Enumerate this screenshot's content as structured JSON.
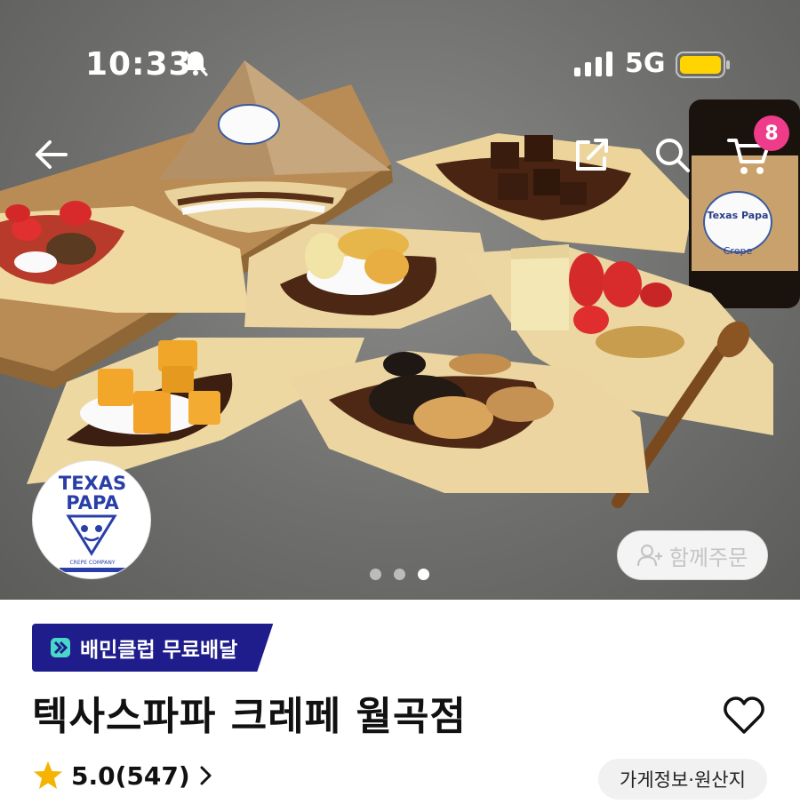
{
  "status_bar": {
    "time": "10:33",
    "network": "5G"
  },
  "nav": {
    "cart_count": "8"
  },
  "hero": {
    "cup_brand": "Texas Papa",
    "cup_sub": "Crepe",
    "slide_count": 3,
    "active_slide_index": 2,
    "together_order_label": "함께주문"
  },
  "logo": {
    "line1": "TEXAS",
    "line2": "PAPA",
    "sub": "CREPE COMPANY"
  },
  "store": {
    "club_badge": "배민클럽 무료배달",
    "title": "텍사스파파 크레페 월곡점",
    "rating": "5.0(547)",
    "info_button": "가게정보·원산지"
  },
  "colors": {
    "club_badge_bg": "#1f1d8c",
    "cart_badge": "#ee3c8a",
    "star": "#f5b400"
  }
}
